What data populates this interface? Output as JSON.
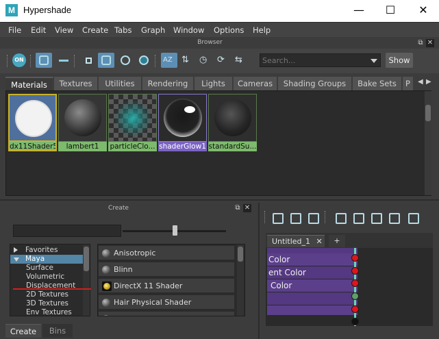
{
  "window": {
    "title": "Hypershade",
    "app_icon_letter": "M",
    "minimize": "—",
    "maximize": "☐",
    "close": "✕"
  },
  "menu": [
    "File",
    "Edit",
    "View",
    "Create",
    "Tabs",
    "Graph",
    "Window",
    "Options",
    "Help"
  ],
  "browser": {
    "header": "Browser",
    "toolbar": {
      "on_label": "ON",
      "sort_label": "AZ"
    },
    "search_placeholder": "Search...",
    "show_label": "Show",
    "tabs": [
      "Materials",
      "Textures",
      "Utilities",
      "Rendering",
      "Lights",
      "Cameras",
      "Shading Groups",
      "Bake Sets",
      "P"
    ],
    "active_tab": "Materials",
    "materials": [
      {
        "name": "dx11Shader5",
        "selected": true
      },
      {
        "name": "lambert1"
      },
      {
        "name": "particleClo..."
      },
      {
        "name": "shaderGlow1"
      },
      {
        "name": "standardSu..."
      }
    ]
  },
  "create": {
    "header": "Create",
    "categories": [
      {
        "label": "Favorites",
        "expanded": false
      },
      {
        "label": "Maya",
        "expanded": true,
        "selected": true
      },
      {
        "label": "Surface"
      },
      {
        "label": "Volumetric"
      },
      {
        "label": "Displacement"
      },
      {
        "label": "2D Textures"
      },
      {
        "label": "3D Textures"
      },
      {
        "label": "Env Textures"
      }
    ],
    "shaders": [
      "Anisotropic",
      "Blinn",
      "DirectX 11 Shader",
      "Hair Physical Shader"
    ],
    "highlighted_shader": "DirectX 11 Shader",
    "bottom_tabs": [
      "Create",
      "Bins"
    ],
    "active_bottom_tab": "Create"
  },
  "node_editor": {
    "tab_label": "Untitled_1",
    "tab_close": "✕",
    "add_tab": "+",
    "rows": [
      "Color",
      "ent Color",
      "Color",
      "",
      "",
      ""
    ],
    "port_colors": [
      "#e0141b",
      "#e0141b",
      "#e0141b",
      "#5f9e6a",
      "#e0141b",
      "#111111"
    ]
  },
  "colors": {
    "accent": "#5d8fb5",
    "swatch_label_green": "#7dba6d",
    "swatch_label_purple": "#7a63c4",
    "node_row": "#5b3f8a"
  }
}
